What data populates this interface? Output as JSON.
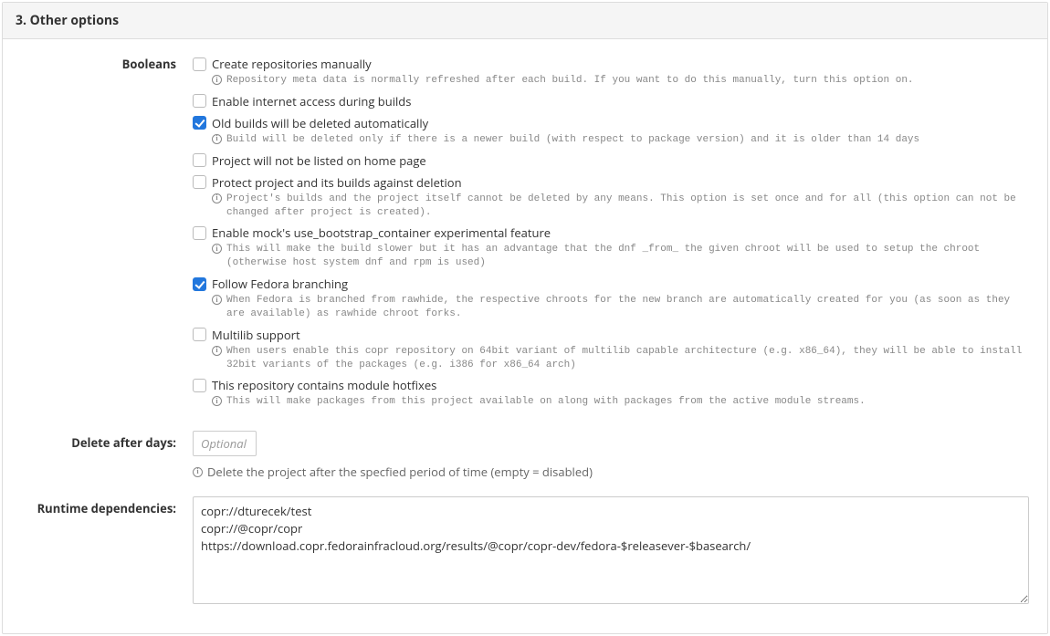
{
  "panel": {
    "title": "3. Other options"
  },
  "booleans": {
    "label": "Booleans",
    "items": [
      {
        "label": "Create repositories manually",
        "checked": false,
        "help": "Repository meta data is normally refreshed after each build. If you want to do this manually, turn this option on."
      },
      {
        "label": "Enable internet access during builds",
        "checked": false,
        "help": null
      },
      {
        "label": "Old builds will be deleted automatically",
        "checked": true,
        "help": "Build will be deleted only if there is a newer build (with respect to package version) and it is older than 14 days"
      },
      {
        "label": "Project will not be listed on home page",
        "checked": false,
        "help": null
      },
      {
        "label": "Protect project and its builds against deletion",
        "checked": false,
        "help": "Project's builds and the project itself cannot be deleted by any means. This option is set once and for all (this option can not be changed after project is created)."
      },
      {
        "label": "Enable mock's use_bootstrap_container experimental feature",
        "checked": false,
        "help": "This will make the build slower but it has an advantage that the dnf _from_ the given chroot will be used to setup the chroot (otherwise host system dnf and rpm is used)"
      },
      {
        "label": "Follow Fedora branching",
        "checked": true,
        "help": "When Fedora is branched from rawhide, the respective chroots for the new branch are automatically created for you (as soon as they are available) as rawhide chroot forks."
      },
      {
        "label": "Multilib support",
        "checked": false,
        "help": "When users enable this copr repository on 64bit variant of multilib capable architecture (e.g. x86_64), they will be able to install 32bit variants of the packages (e.g. i386 for x86_64 arch)"
      },
      {
        "label": "This repository contains module hotfixes",
        "checked": false,
        "help": "This will make packages from this project available on along with packages from the active module streams."
      }
    ]
  },
  "delete_after": {
    "label": "Delete after days:",
    "placeholder": "Optional",
    "value": "",
    "help": "Delete the project after the specfied period of time (empty = disabled)"
  },
  "runtime_deps": {
    "label": "Runtime dependencies:",
    "value": "copr://dturecek/test\ncopr://@copr/copr\nhttps://download.copr.fedorainfracloud.org/results/@copr/copr-dev/fedora-$releasever-$basearch/"
  }
}
